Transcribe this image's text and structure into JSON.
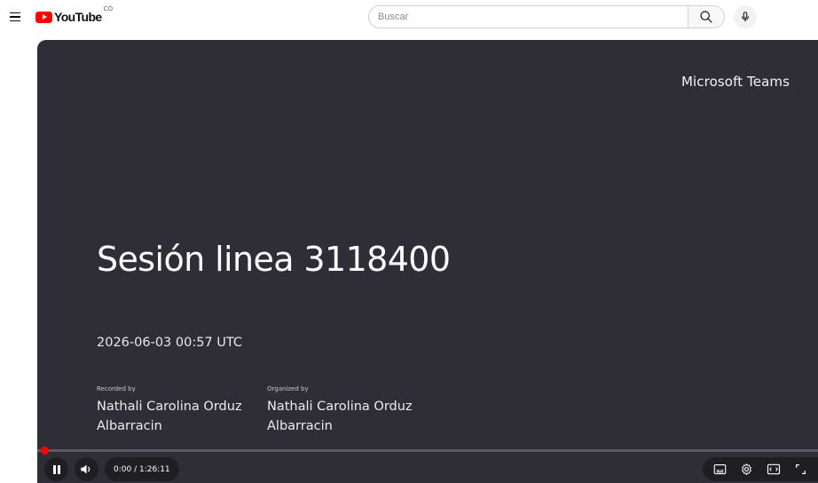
{
  "header": {
    "logo_text": "YouTube",
    "logo_sup": "CO",
    "search_placeholder": "Buscar",
    "search_value": ""
  },
  "video": {
    "brand": "Microsoft Teams",
    "title": "Sesión linea 3118400",
    "datetime": "2026-06-03 00:57 UTC",
    "recorded_label": "Recorded by",
    "recorded_name": "Nathali Carolina Orduz Albarracin",
    "organized_label": "Organized by",
    "organized_name": "Nathali Carolina Orduz Albarracin"
  },
  "player": {
    "time_display": "0:00 / 1:26:11",
    "progress": 0.0,
    "state": "playing"
  },
  "colors": {
    "brand_red": "#ff0000",
    "player_bg": "#2f2e37"
  },
  "icons": [
    "menu-icon",
    "youtube-logo-icon",
    "search-icon",
    "microphone-icon",
    "pause-icon",
    "volume-icon",
    "subtitles-icon",
    "settings-gear-icon",
    "theater-mode-icon",
    "fullscreen-icon"
  ]
}
